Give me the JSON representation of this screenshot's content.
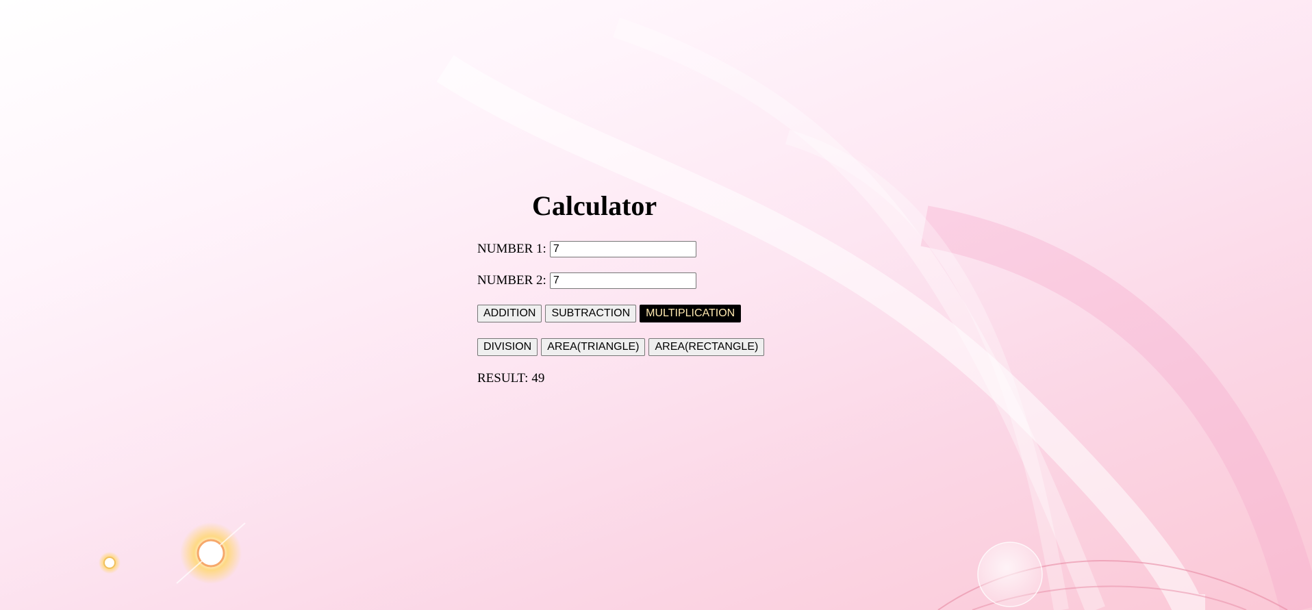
{
  "title": "Calculator",
  "number1": {
    "label": "NUMBER 1:",
    "value": "7"
  },
  "number2": {
    "label": "NUMBER 2:",
    "value": "7"
  },
  "buttons_row1": [
    {
      "label": "ADDITION"
    },
    {
      "label": "SUBTRACTION"
    },
    {
      "label": "MULTIPLICATION",
      "active": true
    }
  ],
  "buttons_row2": [
    {
      "label": "DIVISION"
    },
    {
      "label": "AREA(TRIANGLE)"
    },
    {
      "label": "AREA(RECTANGLE)"
    }
  ],
  "result": {
    "label": "RESULT:",
    "value": "49"
  },
  "colors": {
    "active_button_bg": "#000000",
    "active_button_text": "#ffe9b0",
    "background_light": "#ffffff",
    "background_pink": "#fbc8d6"
  }
}
